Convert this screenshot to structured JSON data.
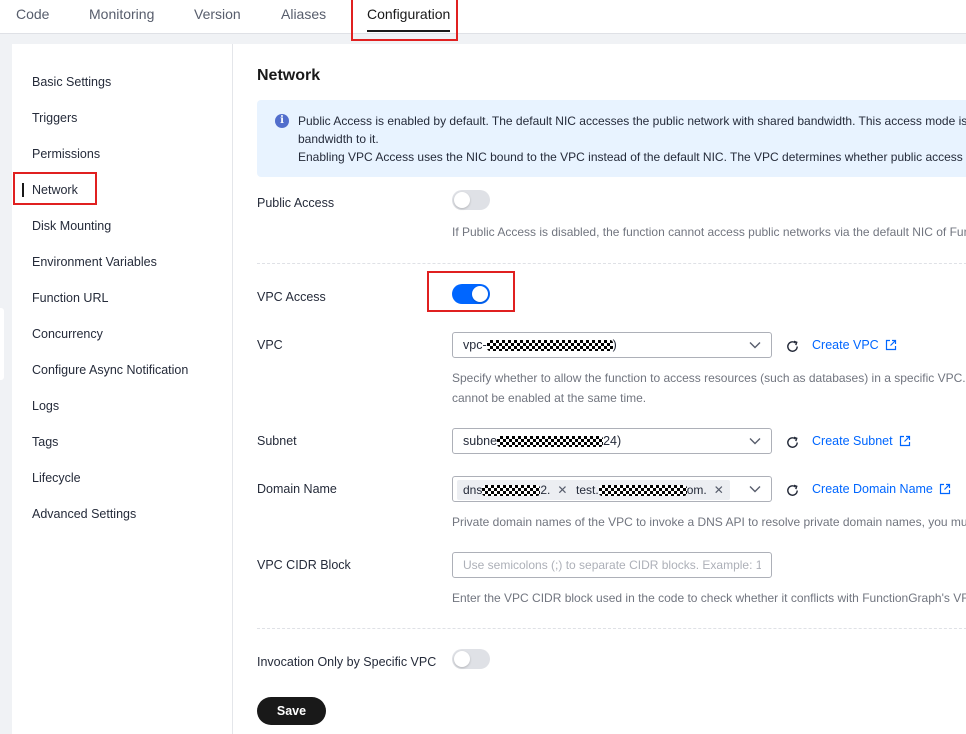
{
  "tabs": [
    {
      "label": "Code"
    },
    {
      "label": "Monitoring"
    },
    {
      "label": "Version"
    },
    {
      "label": "Aliases"
    },
    {
      "label": "Configuration",
      "active": true
    }
  ],
  "sidebar": {
    "items": [
      {
        "label": "Basic Settings"
      },
      {
        "label": "Triggers"
      },
      {
        "label": "Permissions"
      },
      {
        "label": "Network",
        "active": true
      },
      {
        "label": "Disk Mounting"
      },
      {
        "label": "Environment Variables"
      },
      {
        "label": "Function URL"
      },
      {
        "label": "Concurrency"
      },
      {
        "label": "Configure Async Notification"
      },
      {
        "label": "Logs"
      },
      {
        "label": "Tags"
      },
      {
        "label": "Lifecycle"
      },
      {
        "label": "Advanced Settings"
      }
    ]
  },
  "section": {
    "title": "Network",
    "info": {
      "line1": "Public Access is enabled by default. The default NIC accesses the public network with shared bandwidth. This access mode is",
      "line2": "bandwidth to it.",
      "line3": "Enabling VPC Access uses the NIC bound to the VPC instead of the default NIC. The VPC determines whether public access"
    }
  },
  "public_access": {
    "label": "Public Access",
    "enabled": false,
    "hint": "If Public Access is disabled, the function cannot access public networks via the default NIC of Fun"
  },
  "vpc_access": {
    "label": "VPC Access",
    "enabled": true
  },
  "vpc": {
    "label": "VPC",
    "value_prefix": "vpc-",
    "value_suffix": ")",
    "create_link": "Create VPC",
    "hint_line1": "Specify whether to allow the function to access resources (such as databases) in a specific VPC.",
    "hint_line2": "cannot be enabled at the same time."
  },
  "subnet": {
    "label": "Subnet",
    "value_prefix": "subne",
    "value_suffix": "24)",
    "create_link": "Create Subnet"
  },
  "domain_name": {
    "label": "Domain Name",
    "chips": [
      {
        "prefix": "dns",
        "suffix": "2."
      },
      {
        "prefix": "test.",
        "suffix": "om."
      }
    ],
    "create_link": "Create Domain Name",
    "hint": "Private domain names of the VPC to invoke a DNS API to resolve private domain names, you mu"
  },
  "vpc_cidr": {
    "label": "VPC CIDR Block",
    "placeholder": "Use semicolons (;) to separate CIDR blocks. Example: 1",
    "hint": "Enter the VPC CIDR block used in the code to check whether it conflicts with FunctionGraph's VF"
  },
  "invocation_only": {
    "label": "Invocation Only by Specific VPC",
    "enabled": false
  },
  "save_label": "Save",
  "colors": {
    "accent": "#0066ff",
    "highlight": "#e02020",
    "primary_button": "#191919",
    "info_bg": "#e8f3ff"
  }
}
